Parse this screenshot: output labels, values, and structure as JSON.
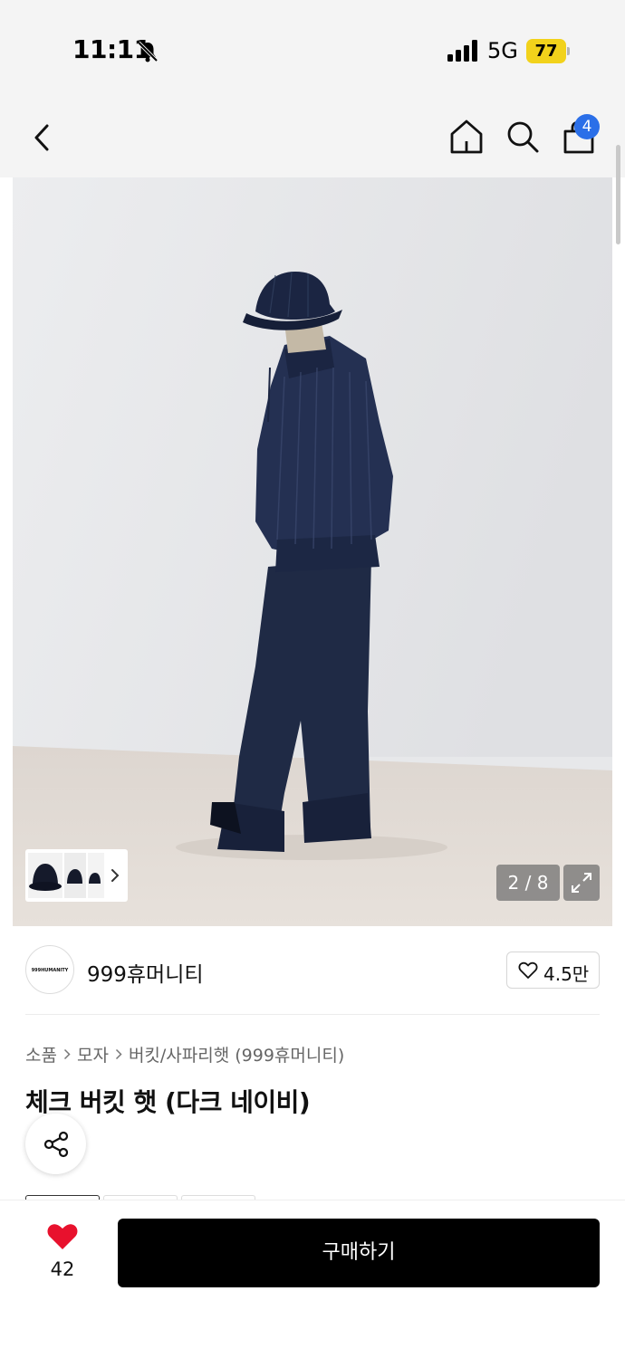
{
  "status_bar": {
    "time": "11:11",
    "network": "5G",
    "battery": "77"
  },
  "nav": {
    "cart_count": "4"
  },
  "gallery": {
    "counter": "2 / 8"
  },
  "brand": {
    "logo_text": "999HUMANITY",
    "name": "999휴머니티",
    "like_count": "4.5만"
  },
  "breadcrumb": [
    "소품",
    "모자",
    "버킷/사파리햇 (999휴머니티)"
  ],
  "product": {
    "title": "체크 버킷 햇 (다크 네이비)"
  },
  "bottom_bar": {
    "wish_count": "42",
    "buy_label": "구매하기"
  },
  "colors": {
    "badge": "#2b6fe8",
    "heart": "#e8112d",
    "battery": "#f2d21b",
    "buy_button": "#000000"
  },
  "icons": [
    "bell-slash-icon",
    "signal-icon",
    "back-icon",
    "home-icon",
    "search-icon",
    "shopping-bag-icon",
    "chevron-right-icon",
    "expand-icon",
    "heart-outline-icon",
    "share-icon",
    "heart-filled-icon"
  ]
}
